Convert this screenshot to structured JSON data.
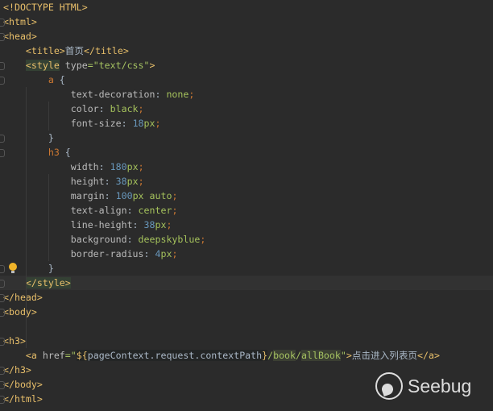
{
  "editor": {
    "current_line": 19,
    "lines": [
      [
        {
          "t": "<!DOCTYPE HTML>",
          "c": "tag"
        }
      ],
      [
        {
          "t": "<html>",
          "c": "tag"
        }
      ],
      [
        {
          "t": "<head>",
          "c": "tag"
        }
      ],
      [
        {
          "t": "    ",
          "c": "txt"
        },
        {
          "t": "<title>",
          "c": "tag"
        },
        {
          "t": "首页",
          "c": "txt"
        },
        {
          "t": "</title>",
          "c": "tag"
        }
      ],
      [
        {
          "t": "    ",
          "c": "txt"
        },
        {
          "t": "<style",
          "c": "tag hl"
        },
        {
          "t": " type",
          "c": "attr"
        },
        {
          "t": "=\"text/css\"",
          "c": "str"
        },
        {
          "t": ">",
          "c": "tag"
        }
      ],
      [
        {
          "t": "        ",
          "c": "txt"
        },
        {
          "t": "a",
          "c": "sel"
        },
        {
          "t": " {",
          "c": "txt"
        }
      ],
      [
        {
          "t": "            ",
          "c": "txt"
        },
        {
          "t": "text-decoration",
          "c": "prop"
        },
        {
          "t": ": ",
          "c": "txt"
        },
        {
          "t": "none",
          "c": "val"
        },
        {
          "t": ";",
          "c": "punc"
        }
      ],
      [
        {
          "t": "            ",
          "c": "txt"
        },
        {
          "t": "color",
          "c": "prop"
        },
        {
          "t": ": ",
          "c": "txt"
        },
        {
          "t": "black",
          "c": "val"
        },
        {
          "t": ";",
          "c": "punc"
        }
      ],
      [
        {
          "t": "            ",
          "c": "txt"
        },
        {
          "t": "font-size",
          "c": "prop"
        },
        {
          "t": ": ",
          "c": "txt"
        },
        {
          "t": "18",
          "c": "num"
        },
        {
          "t": "px",
          "c": "val"
        },
        {
          "t": ";",
          "c": "punc"
        }
      ],
      [
        {
          "t": "        }",
          "c": "txt"
        }
      ],
      [
        {
          "t": "        ",
          "c": "txt"
        },
        {
          "t": "h3",
          "c": "sel"
        },
        {
          "t": " {",
          "c": "txt"
        }
      ],
      [
        {
          "t": "            ",
          "c": "txt"
        },
        {
          "t": "width",
          "c": "prop"
        },
        {
          "t": ": ",
          "c": "txt"
        },
        {
          "t": "180",
          "c": "num"
        },
        {
          "t": "px",
          "c": "val"
        },
        {
          "t": ";",
          "c": "punc"
        }
      ],
      [
        {
          "t": "            ",
          "c": "txt"
        },
        {
          "t": "height",
          "c": "prop"
        },
        {
          "t": ": ",
          "c": "txt"
        },
        {
          "t": "38",
          "c": "num"
        },
        {
          "t": "px",
          "c": "val"
        },
        {
          "t": ";",
          "c": "punc"
        }
      ],
      [
        {
          "t": "            ",
          "c": "txt"
        },
        {
          "t": "margin",
          "c": "prop"
        },
        {
          "t": ": ",
          "c": "txt"
        },
        {
          "t": "100",
          "c": "num"
        },
        {
          "t": "px auto",
          "c": "val"
        },
        {
          "t": ";",
          "c": "punc"
        }
      ],
      [
        {
          "t": "            ",
          "c": "txt"
        },
        {
          "t": "text-align",
          "c": "prop"
        },
        {
          "t": ": ",
          "c": "txt"
        },
        {
          "t": "center",
          "c": "val"
        },
        {
          "t": ";",
          "c": "punc"
        }
      ],
      [
        {
          "t": "            ",
          "c": "txt"
        },
        {
          "t": "line-height",
          "c": "prop"
        },
        {
          "t": ": ",
          "c": "txt"
        },
        {
          "t": "38",
          "c": "num"
        },
        {
          "t": "px",
          "c": "val"
        },
        {
          "t": ";",
          "c": "punc"
        }
      ],
      [
        {
          "t": "            ",
          "c": "txt"
        },
        {
          "t": "background",
          "c": "prop"
        },
        {
          "t": ": ",
          "c": "txt"
        },
        {
          "t": "deepskyblue",
          "c": "val"
        },
        {
          "t": ";",
          "c": "punc"
        }
      ],
      [
        {
          "t": "            ",
          "c": "txt"
        },
        {
          "t": "border-radius",
          "c": "prop"
        },
        {
          "t": ": ",
          "c": "txt"
        },
        {
          "t": "4",
          "c": "num"
        },
        {
          "t": "px",
          "c": "val"
        },
        {
          "t": ";",
          "c": "punc"
        }
      ],
      [
        {
          "t": "        }",
          "c": "txt"
        }
      ],
      [
        {
          "t": "    ",
          "c": "txt"
        },
        {
          "t": "</style>",
          "c": "tag hl"
        }
      ],
      [
        {
          "t": "</head>",
          "c": "tag"
        }
      ],
      [
        {
          "t": "<body>",
          "c": "tag"
        }
      ],
      [
        {
          "t": "",
          "c": "txt"
        }
      ],
      [
        {
          "t": "<h3>",
          "c": "tag"
        }
      ],
      [
        {
          "t": "    ",
          "c": "txt"
        },
        {
          "t": "<a",
          "c": "tag"
        },
        {
          "t": " href",
          "c": "attr"
        },
        {
          "t": "=\"",
          "c": "str"
        },
        {
          "t": "${",
          "c": "tag el"
        },
        {
          "t": "pageContext.request.contextPath",
          "c": "txt el"
        },
        {
          "t": "}",
          "c": "tag el"
        },
        {
          "t": "/",
          "c": "str"
        },
        {
          "t": "book",
          "c": "str hl2"
        },
        {
          "t": "/",
          "c": "str"
        },
        {
          "t": "allBook",
          "c": "str hl2"
        },
        {
          "t": "\"",
          "c": "str"
        },
        {
          "t": ">",
          "c": "tag"
        },
        {
          "t": "点击进入列表页",
          "c": "txt"
        },
        {
          "t": "</a>",
          "c": "tag"
        }
      ],
      [
        {
          "t": "</h3>",
          "c": "tag"
        }
      ],
      [
        {
          "t": "</body>",
          "c": "tag"
        }
      ],
      [
        {
          "t": "</html>",
          "c": "tag"
        }
      ]
    ]
  },
  "watermark": {
    "text": "Seebug"
  }
}
